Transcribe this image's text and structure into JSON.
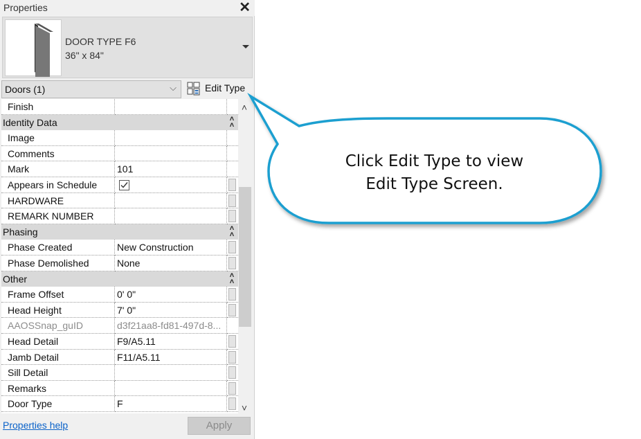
{
  "panel": {
    "title": "Properties",
    "close_icon": "close-icon"
  },
  "type_selector": {
    "name": "DOOR TYPE F6",
    "size": "36\" x 84\"",
    "icon": "door-icon"
  },
  "category_filter": {
    "value": "Doors (1)"
  },
  "edit_type": {
    "label": "Edit Type",
    "icon": "edit-type-icon"
  },
  "grid": {
    "rows": [
      {
        "kind": "prop",
        "name": "Finish",
        "value": ""
      },
      {
        "kind": "group",
        "name": "Identity Data"
      },
      {
        "kind": "prop",
        "name": "Image",
        "value": ""
      },
      {
        "kind": "prop",
        "name": "Comments",
        "value": ""
      },
      {
        "kind": "prop",
        "name": "Mark",
        "value": "101"
      },
      {
        "kind": "prop",
        "name": "Appears in Schedule",
        "value": "",
        "checkbox": true,
        "checked": true
      },
      {
        "kind": "prop",
        "name": "HARDWARE",
        "value": ""
      },
      {
        "kind": "prop",
        "name": "REMARK NUMBER",
        "value": ""
      },
      {
        "kind": "group",
        "name": "Phasing"
      },
      {
        "kind": "prop",
        "name": "Phase Created",
        "value": "New Construction"
      },
      {
        "kind": "prop",
        "name": "Phase Demolished",
        "value": "None"
      },
      {
        "kind": "group",
        "name": "Other"
      },
      {
        "kind": "prop",
        "name": "Frame Offset",
        "value": "0'  0\""
      },
      {
        "kind": "prop",
        "name": "Head Height",
        "value": "7'  0\""
      },
      {
        "kind": "prop",
        "name": "AAOSSnap_guID",
        "value": "d3f21aa8-fd81-497d-8...",
        "disabled": true
      },
      {
        "kind": "prop",
        "name": "Head Detail",
        "value": "F9/A5.11"
      },
      {
        "kind": "prop",
        "name": "Jamb Detail",
        "value": "F11/A5.11"
      },
      {
        "kind": "prop",
        "name": "Sill Detail",
        "value": ""
      },
      {
        "kind": "prop",
        "name": "Remarks",
        "value": ""
      },
      {
        "kind": "prop",
        "name": "Door Type",
        "value": "F"
      }
    ]
  },
  "footer": {
    "help_link": "Properties help",
    "apply_label": "Apply"
  },
  "callout": {
    "line1": "Click Edit Type to view",
    "line2": "Edit Type Screen.",
    "border_color": "#1a9fd0"
  }
}
